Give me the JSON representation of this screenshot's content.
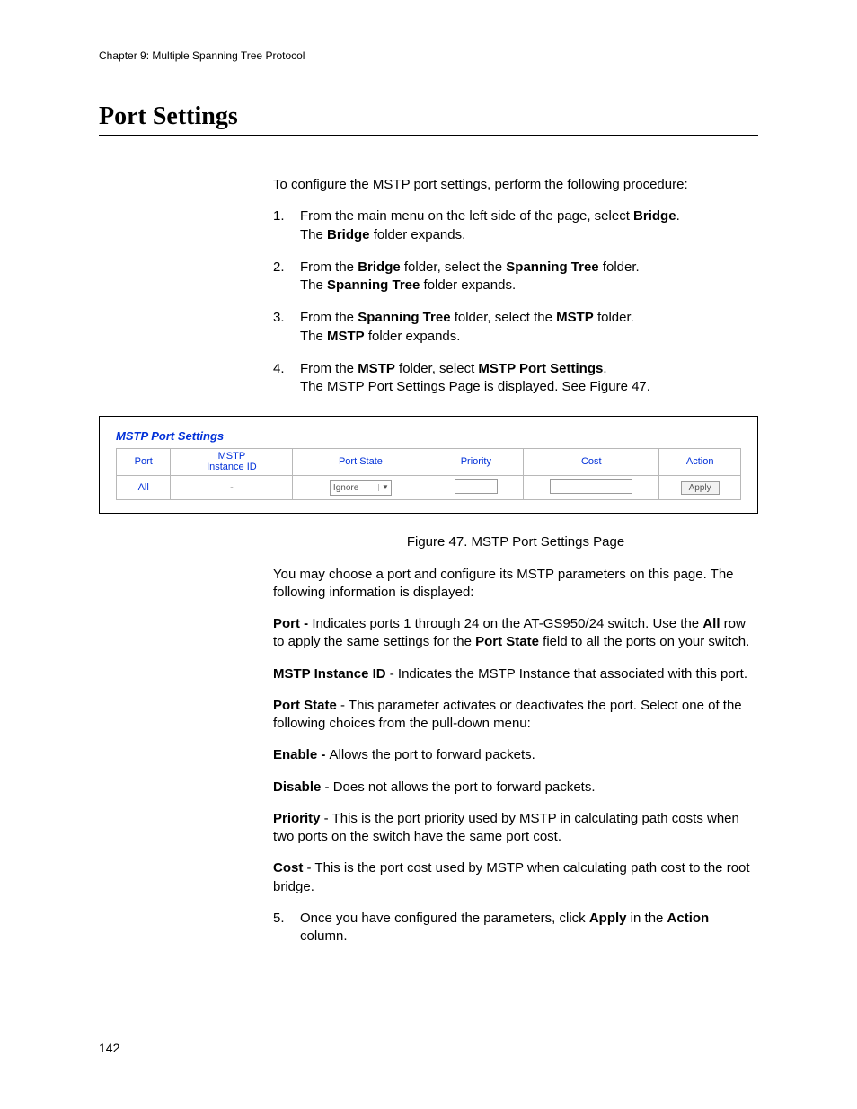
{
  "chapter_header": "Chapter 9: Multiple Spanning Tree Protocol",
  "title": "Port Settings",
  "intro": "To configure the MSTP port settings, perform the following procedure:",
  "steps": [
    {
      "num": "1.",
      "lines": [
        {
          "segs": [
            {
              "t": "From the main menu on the left side of the page, select "
            },
            {
              "t": "Bridge",
              "b": true
            },
            {
              "t": "."
            }
          ]
        },
        {
          "segs": [
            {
              "t": "The "
            },
            {
              "t": "Bridge",
              "b": true
            },
            {
              "t": " folder expands."
            }
          ]
        }
      ]
    },
    {
      "num": "2.",
      "lines": [
        {
          "segs": [
            {
              "t": "From the "
            },
            {
              "t": "Bridge",
              "b": true
            },
            {
              "t": " folder, select the "
            },
            {
              "t": "Spanning Tree",
              "b": true
            },
            {
              "t": " folder."
            }
          ]
        },
        {
          "segs": [
            {
              "t": "The "
            },
            {
              "t": "Spanning Tree",
              "b": true
            },
            {
              "t": " folder expands."
            }
          ]
        }
      ]
    },
    {
      "num": "3.",
      "lines": [
        {
          "segs": [
            {
              "t": "From the "
            },
            {
              "t": "Spanning Tree",
              "b": true
            },
            {
              "t": " folder, select the "
            },
            {
              "t": "MSTP",
              "b": true
            },
            {
              "t": " folder."
            }
          ]
        },
        {
          "segs": [
            {
              "t": "The "
            },
            {
              "t": "MSTP",
              "b": true
            },
            {
              "t": " folder expands."
            }
          ]
        }
      ]
    },
    {
      "num": "4.",
      "lines": [
        {
          "segs": [
            {
              "t": "From the "
            },
            {
              "t": "MSTP",
              "b": true
            },
            {
              "t": " folder, select "
            },
            {
              "t": "MSTP Port Settings",
              "b": true
            },
            {
              "t": "."
            }
          ]
        },
        {
          "segs": [
            {
              "t": "The MSTP Port Settings Page is displayed. See Figure 47."
            }
          ]
        }
      ]
    }
  ],
  "figure": {
    "title": "MSTP Port Settings",
    "headers": {
      "port": "Port",
      "instance": "MSTP\nInstance ID",
      "state": "Port State",
      "priority": "Priority",
      "cost": "Cost",
      "action": "Action"
    },
    "row": {
      "port": "All",
      "instance": "-",
      "state": "Ignore",
      "action": "Apply"
    },
    "caption": "Figure 47. MSTP Port Settings Page"
  },
  "after": [
    {
      "indent": 0,
      "segs": [
        {
          "t": "You may choose a port and configure its MSTP parameters on this page. The following information is displayed:"
        }
      ]
    },
    {
      "indent": 1,
      "segs": [
        {
          "t": "Port - ",
          "b": true
        },
        {
          "t": "Indicates ports 1 through 24 on the AT-GS950/24 switch. Use the "
        },
        {
          "t": "All",
          "b": true
        },
        {
          "t": " row to apply the same settings for the "
        },
        {
          "t": "Port State",
          "b": true
        },
        {
          "t": " field to all the ports on your switch."
        }
      ]
    },
    {
      "indent": 1,
      "segs": [
        {
          "t": "MSTP Instance ID",
          "b": true
        },
        {
          "t": " - Indicates the MSTP Instance that associated with this port."
        }
      ]
    },
    {
      "indent": 1,
      "segs": [
        {
          "t": "Port State",
          "b": true
        },
        {
          "t": " - This parameter activates or deactivates the port. Select one of the following choices from the pull-down menu:"
        }
      ]
    },
    {
      "indent": 2,
      "segs": [
        {
          "t": "Enable - ",
          "b": true
        },
        {
          "t": "Allows the port to forward packets."
        }
      ]
    },
    {
      "indent": 2,
      "segs": [
        {
          "t": "Disable",
          "b": true
        },
        {
          "t": " - Does not allows the port to forward packets."
        }
      ]
    },
    {
      "indent": 1,
      "segs": [
        {
          "t": "Priority",
          "b": true
        },
        {
          "t": " - This is the port priority used by MSTP in calculating path costs when two ports on the switch have the same port cost."
        }
      ]
    },
    {
      "indent": 1,
      "segs": [
        {
          "t": "Cost",
          "b": true
        },
        {
          "t": " - This is the port cost used by MSTP when calculating path cost to the root bridge."
        }
      ]
    }
  ],
  "step5": {
    "num": "5.",
    "lines": [
      {
        "segs": [
          {
            "t": "Once you have configured the parameters, click "
          },
          {
            "t": "Apply",
            "b": true
          },
          {
            "t": " in the "
          },
          {
            "t": "Action",
            "b": true
          },
          {
            "t": " column."
          }
        ]
      }
    ]
  },
  "page_number": "142"
}
